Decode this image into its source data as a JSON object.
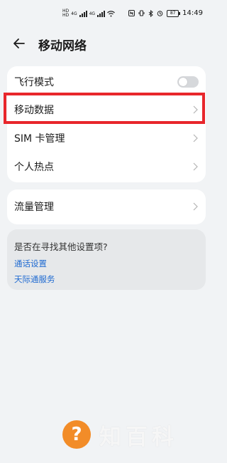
{
  "status_bar": {
    "time": "14:49",
    "battery": "87",
    "sim1_tag": "HD",
    "sim2_tag": "HD",
    "network1": "4G",
    "network2": "4G",
    "icons": [
      "nfc-icon",
      "vibrate-icon",
      "bluetooth-icon",
      "alarm-icon",
      "wifi-icon"
    ]
  },
  "header": {
    "title": "移动网络",
    "back_icon": "arrow-left-icon"
  },
  "settings": {
    "airplane_mode": {
      "label": "飞行模式",
      "enabled": false
    },
    "mobile_data": {
      "label": "移动数据"
    },
    "sim_management": {
      "label": "SIM 卡管理"
    },
    "hotspot": {
      "label": "个人热点"
    },
    "data_usage": {
      "label": "流量管理"
    }
  },
  "suggestions": {
    "question": "是否在寻找其他设置项?",
    "links": [
      "通话设置",
      "天际通服务"
    ]
  },
  "watermark": {
    "icon_text": "?",
    "text": "知百科"
  },
  "colors": {
    "highlight": "#e8262b",
    "link": "#1f6ad1",
    "watermark_icon": "#f28c28"
  }
}
